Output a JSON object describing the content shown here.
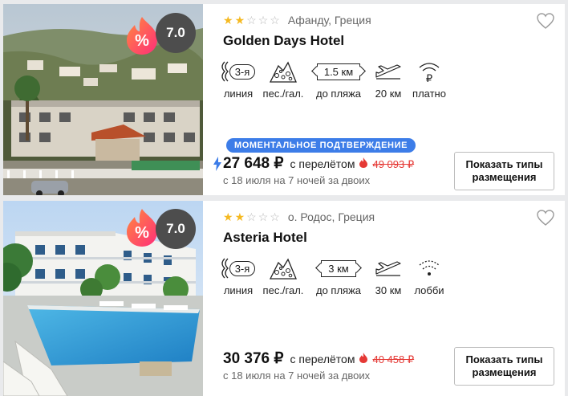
{
  "hotels": [
    {
      "rating": "7.0",
      "stars": 2,
      "max_stars": 5,
      "location": "Афанду, Греция",
      "name": "Golden Days Hotel",
      "amenities": {
        "line": {
          "value": "3-я",
          "label": "линия"
        },
        "beach_type": {
          "label": "пес./гал."
        },
        "beach_distance": {
          "value": "1.5 км",
          "label": "до пляжа"
        },
        "airport": {
          "label": "20 км"
        },
        "wifi": {
          "label": "платно"
        }
      },
      "instant_confirm": "МОМЕНТАЛЬНОЕ ПОДТВЕРЖДЕНИЕ",
      "price": "27 648 ₽",
      "price_note": "с перелётом",
      "old_price": "49 093 ₽",
      "dates": "с 18 июля на 7 ночей за двоих",
      "button": "Показать типы размещения"
    },
    {
      "rating": "7.0",
      "stars": 2,
      "max_stars": 5,
      "location": "о. Родос, Греция",
      "name": "Asteria Hotel",
      "amenities": {
        "line": {
          "value": "3-я",
          "label": "линия"
        },
        "beach_type": {
          "label": "пес./гал."
        },
        "beach_distance": {
          "value": "3 км",
          "label": "до пляжа"
        },
        "airport": {
          "label": "30 км"
        },
        "wifi": {
          "label": "лобби"
        }
      },
      "price": "30 376 ₽",
      "price_note": "с перелётом",
      "old_price": "40 458 ₽",
      "dates": "с 18 июля на 7 ночей за двоих",
      "button": "Показать типы размещения"
    }
  ],
  "icons": {
    "discount": "percent-fire-icon",
    "heart": "heart-outline-icon",
    "line": "waves-line-icon",
    "beach": "pebbles-icon",
    "airport": "airplane-icon",
    "wifi_paid": "wifi-ruble-icon",
    "wifi": "wifi-icon",
    "fire": "fire-icon",
    "bolt": "lightning-icon"
  },
  "colors": {
    "accent": "#3d7de8",
    "old_price": "#e53935",
    "star": "#f5b921",
    "rating_bg": "#4d4d4d",
    "discount_gradient": [
      "#ff3d7f",
      "#ff8a3d"
    ]
  }
}
